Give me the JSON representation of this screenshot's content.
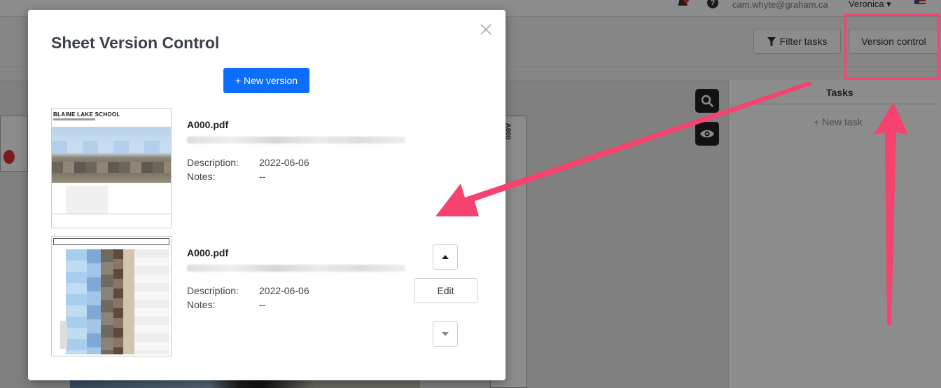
{
  "topbar": {
    "email": "cam.whyte@graham.ca",
    "user": "Veronica",
    "user_caret": "▾"
  },
  "toolbar": {
    "filter_label": "Filter tasks",
    "version_control_label": "Version control"
  },
  "tasks": {
    "title": "Tasks",
    "new_task": "+ New task"
  },
  "sheet": {
    "side_label": "A000"
  },
  "modal": {
    "title": "Sheet Version Control",
    "new_version_label": "+ New version",
    "description_label": "Description:",
    "notes_label": "Notes:",
    "versions": [
      {
        "file": "A000.pdf",
        "thumb_title": "BLAINE LAKE SCHOOL",
        "description": "2022-06-06",
        "notes": "--"
      },
      {
        "file": "A000.pdf",
        "description": "2022-06-06",
        "notes": "--",
        "edit_label": "Edit"
      }
    ]
  },
  "colors": {
    "primary": "#0d6efd",
    "annotation": "#f5426e"
  },
  "icons": [
    "bell-icon",
    "help-icon",
    "flag-icon",
    "filter-icon",
    "search-icon",
    "eye-icon",
    "close-icon",
    "caret-up-icon",
    "caret-down-icon"
  ]
}
